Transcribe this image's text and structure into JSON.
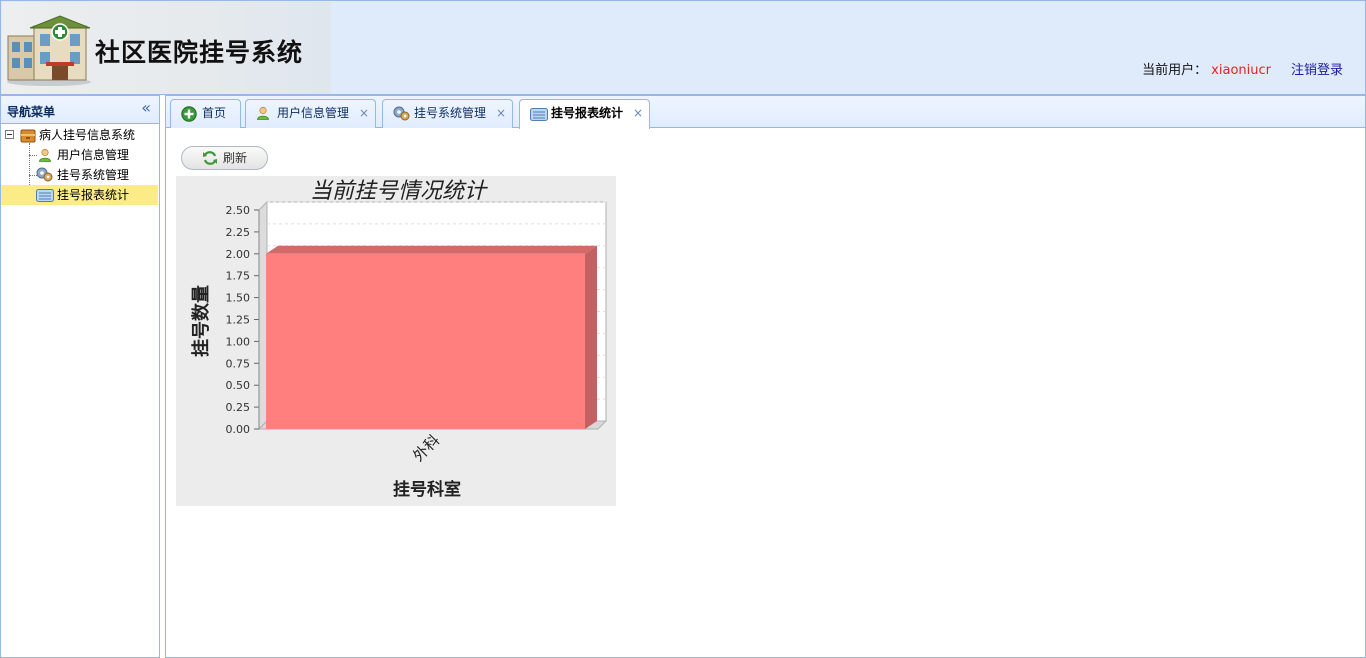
{
  "header": {
    "system_title": "社区医院挂号系统",
    "current_user_label": "当前用户：",
    "current_user": "xiaoniucr",
    "logout_label": "注销登录"
  },
  "sidebar": {
    "title": "导航菜单",
    "collapse_icon": "double-chevron-left-icon",
    "root": {
      "label": "病人挂号信息系统",
      "icon": "folder-icon"
    },
    "items": [
      {
        "label": "用户信息管理",
        "icon": "user-icon"
      },
      {
        "label": "挂号系统管理",
        "icon": "gears-icon"
      },
      {
        "label": "挂号报表统计",
        "icon": "report-icon",
        "selected": true
      }
    ]
  },
  "tabs": [
    {
      "label": "首页",
      "icon": "home-plus-icon",
      "closable": false
    },
    {
      "label": "用户信息管理",
      "icon": "user-icon",
      "closable": true
    },
    {
      "label": "挂号系统管理",
      "icon": "gears-icon",
      "closable": true
    },
    {
      "label": "挂号报表统计",
      "icon": "report-icon",
      "closable": true,
      "active": true
    }
  ],
  "toolbar": {
    "refresh_label": "刷新",
    "refresh_icon": "refresh-icon"
  },
  "chart_data": {
    "type": "bar",
    "title": "当前挂号情况统计",
    "xlabel": "挂号科室",
    "ylabel": "挂号数量",
    "categories": [
      "外科"
    ],
    "values": [
      2
    ],
    "ylim": [
      0,
      2.5
    ],
    "yticks": [
      "0.00",
      "0.25",
      "0.50",
      "0.75",
      "1.00",
      "1.25",
      "1.50",
      "1.75",
      "2.00",
      "2.25",
      "2.50"
    ],
    "grid": true,
    "bar_color": "#ff7f7f",
    "style": "3d"
  }
}
